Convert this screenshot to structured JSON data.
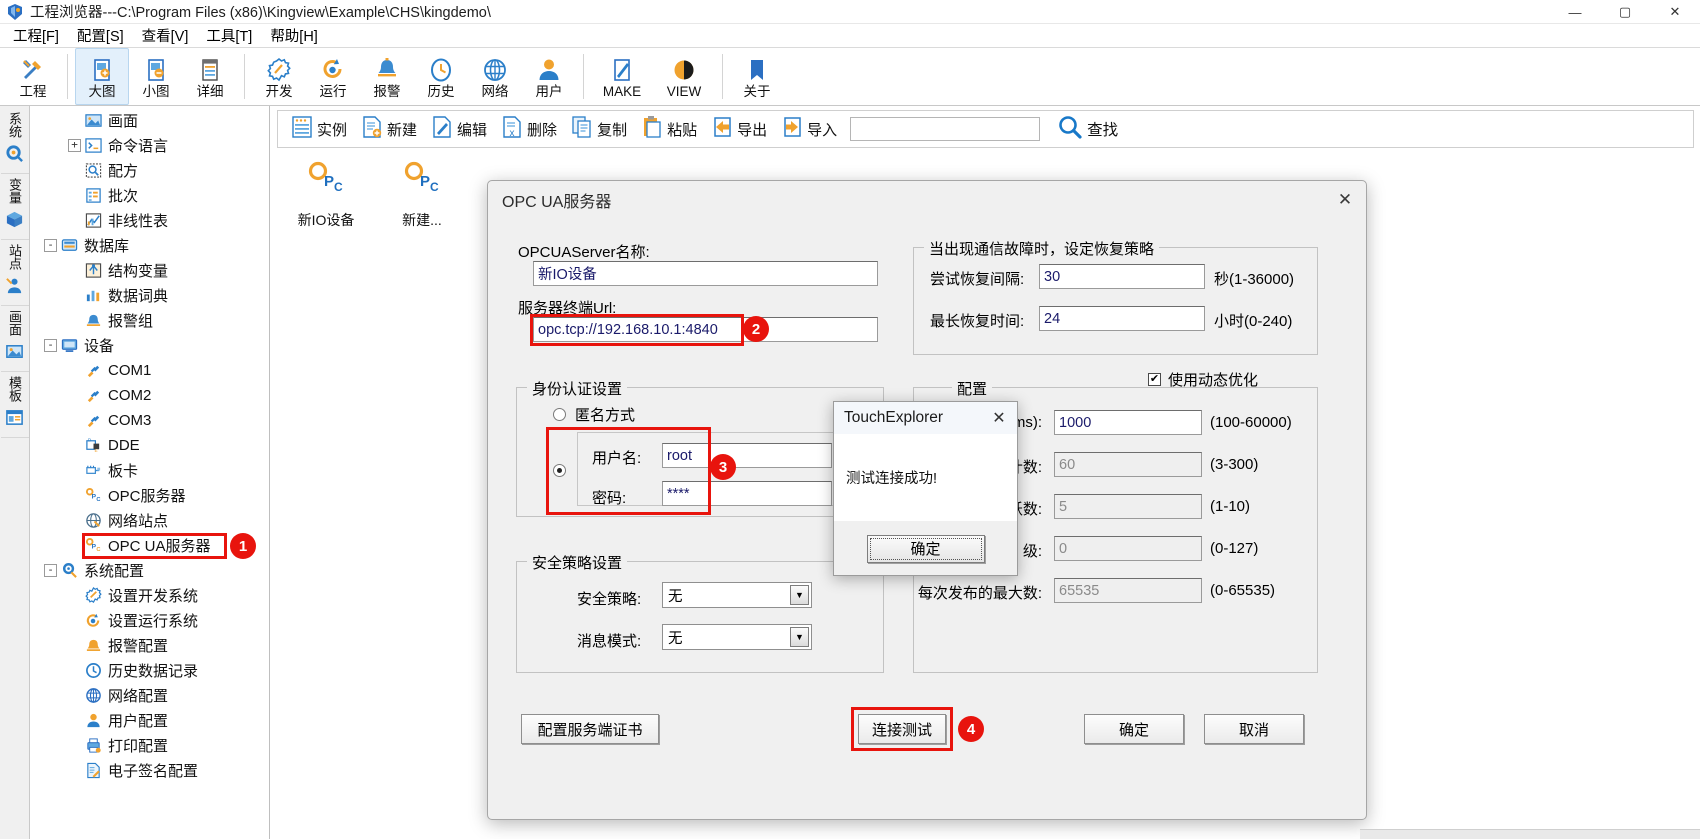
{
  "window": {
    "title": "工程浏览器---C:\\Program Files (x86)\\Kingview\\Example\\CHS\\kingdemo\\",
    "minimize": "—",
    "maximize": "▢",
    "close": "✕"
  },
  "menubar": {
    "items": [
      {
        "label": "工程[F]"
      },
      {
        "label": "配置[S]"
      },
      {
        "label": "查看[V]"
      },
      {
        "label": "工具[T]"
      },
      {
        "label": "帮助[H]"
      }
    ]
  },
  "toolbar": {
    "groups": [
      {
        "items": [
          {
            "label": "工程",
            "icon": "tools-icon",
            "active": false
          }
        ]
      },
      {
        "items": [
          {
            "label": "大图",
            "icon": "large-icons-icon",
            "active": true
          },
          {
            "label": "小图",
            "icon": "small-icons-icon",
            "active": false
          },
          {
            "label": "详细",
            "icon": "details-icon",
            "active": false
          }
        ]
      },
      {
        "items": [
          {
            "label": "开发",
            "icon": "develop-icon",
            "active": false
          },
          {
            "label": "运行",
            "icon": "run-icon",
            "active": false
          },
          {
            "label": "报警",
            "icon": "alarm-icon",
            "active": false
          },
          {
            "label": "历史",
            "icon": "history-icon",
            "active": false
          },
          {
            "label": "网络",
            "icon": "network-icon",
            "active": false
          },
          {
            "label": "用户",
            "icon": "user-icon",
            "active": false
          }
        ]
      },
      {
        "items": [
          {
            "label": "MAKE",
            "icon": "make-icon",
            "active": false
          },
          {
            "label": "VIEW",
            "icon": "view-icon",
            "active": false
          }
        ]
      },
      {
        "items": [
          {
            "label": "关于",
            "icon": "about-icon",
            "active": false
          }
        ]
      }
    ]
  },
  "vtabs": {
    "items": [
      {
        "label": "系统",
        "icon": "system-gear-icon"
      },
      {
        "label": "变量",
        "icon": "variable-box-icon"
      },
      {
        "label": "站点",
        "icon": "site-node-icon"
      },
      {
        "label": "画面",
        "icon": "picture-icon"
      },
      {
        "label": "模板",
        "icon": "template-icon"
      }
    ]
  },
  "tree": {
    "nodes": [
      {
        "label": "画面",
        "depth": 2,
        "expander": "",
        "icon": "picture-node-icon"
      },
      {
        "label": "命令语言",
        "depth": 2,
        "expander": "+",
        "icon": "command-lang-icon"
      },
      {
        "label": "配方",
        "depth": 2,
        "expander": "",
        "icon": "recipe-icon"
      },
      {
        "label": "批次",
        "depth": 2,
        "expander": "",
        "icon": "batch-icon"
      },
      {
        "label": "非线性表",
        "depth": 2,
        "expander": "",
        "icon": "nonlinear-table-icon"
      },
      {
        "label": "数据库",
        "depth": 1,
        "expander": "-",
        "icon": "database-icon"
      },
      {
        "label": "结构变量",
        "depth": 2,
        "expander": "",
        "icon": "struct-var-icon"
      },
      {
        "label": "数据词典",
        "depth": 2,
        "expander": "",
        "icon": "data-dict-icon"
      },
      {
        "label": "报警组",
        "depth": 2,
        "expander": "",
        "icon": "alarm-group-icon"
      },
      {
        "label": "设备",
        "depth": 1,
        "expander": "-",
        "icon": "device-icon"
      },
      {
        "label": "COM1",
        "depth": 2,
        "expander": "",
        "icon": "com-port-icon"
      },
      {
        "label": "COM2",
        "depth": 2,
        "expander": "",
        "icon": "com-port-icon"
      },
      {
        "label": "COM3",
        "depth": 2,
        "expander": "",
        "icon": "com-port-icon"
      },
      {
        "label": "DDE",
        "depth": 2,
        "expander": "",
        "icon": "dde-icon"
      },
      {
        "label": "板卡",
        "depth": 2,
        "expander": "",
        "icon": "board-card-icon"
      },
      {
        "label": "OPC服务器",
        "depth": 2,
        "expander": "",
        "icon": "opc-server-icon"
      },
      {
        "label": "网络站点",
        "depth": 2,
        "expander": "",
        "icon": "net-site-icon"
      },
      {
        "label": "OPC UA服务器",
        "depth": 2,
        "expander": "",
        "icon": "opc-ua-server-icon",
        "highlight": true,
        "badge": "1"
      },
      {
        "label": "系统配置",
        "depth": 1,
        "expander": "-",
        "icon": "sysconfig-icon"
      },
      {
        "label": "设置开发系统",
        "depth": 2,
        "expander": "",
        "icon": "dev-system-icon"
      },
      {
        "label": "设置运行系统",
        "depth": 2,
        "expander": "",
        "icon": "run-system-icon"
      },
      {
        "label": "报警配置",
        "depth": 2,
        "expander": "",
        "icon": "alarm-config-icon"
      },
      {
        "label": "历史数据记录",
        "depth": 2,
        "expander": "",
        "icon": "history-data-icon"
      },
      {
        "label": "网络配置",
        "depth": 2,
        "expander": "",
        "icon": "net-config-icon"
      },
      {
        "label": "用户配置",
        "depth": 2,
        "expander": "",
        "icon": "user-config-icon"
      },
      {
        "label": "打印配置",
        "depth": 2,
        "expander": "",
        "icon": "print-config-icon"
      },
      {
        "label": "电子签名配置",
        "depth": 2,
        "expander": "",
        "icon": "esign-config-icon"
      }
    ]
  },
  "subtoolbar": {
    "buttons": [
      {
        "label": "实例",
        "icon": "instance-icon"
      },
      {
        "label": "新建",
        "icon": "new-icon"
      },
      {
        "label": "编辑",
        "icon": "edit-icon"
      },
      {
        "label": "删除",
        "icon": "delete-icon"
      },
      {
        "label": "复制",
        "icon": "copy-icon"
      },
      {
        "label": "粘贴",
        "icon": "paste-icon"
      },
      {
        "label": "导出",
        "icon": "export-icon"
      },
      {
        "label": "导入",
        "icon": "import-icon"
      }
    ],
    "search_value": "",
    "search_label": "查找",
    "search_icon": "search-icon"
  },
  "desktop_icons": [
    {
      "label": "新IO设备",
      "icon": "opc-device-icon"
    },
    {
      "label": "新建...",
      "icon": "opc-new-icon"
    }
  ],
  "dialog": {
    "title": "OPC UA服务器",
    "close": "✕",
    "server_name_label": "OPCUAServer名称:",
    "server_name_value": "新IO设备",
    "endpoint_label": "服务器终端Url:",
    "endpoint_value": "opc.tcp://192.168.10.1:4840",
    "endpoint_badge": "2",
    "recovery": {
      "title": "当出现通信故障时，设定恢复策略",
      "interval_label": "尝试恢复间隔:",
      "interval_value": "30",
      "interval_unit": "秒(1-36000)",
      "maxtime_label": "最长恢复时间:",
      "maxtime_value": "24",
      "maxtime_unit": "小时(0-240)"
    },
    "dynamic_opt": {
      "label": "使用动态优化",
      "checked": true,
      "mark": "✔"
    },
    "auth": {
      "title": "身份认证设置",
      "anonymous_label": "匿名方式",
      "anonymous_selected": false,
      "userpass_selected": true,
      "username_label": "用户名:",
      "username_value": "root",
      "password_label": "密码:",
      "password_value": "****",
      "badge": "3"
    },
    "security": {
      "title": "安全策略设置",
      "policy_label": "安全策略:",
      "policy_value": "无",
      "mode_label": "消息模式:",
      "mode_value": "无",
      "arrow": "▼"
    },
    "advanced": {
      "title": "配置",
      "rows": [
        {
          "label": "(ms):",
          "value": "1000",
          "range": "(100-60000)",
          "disabled": false
        },
        {
          "label": "计数:",
          "value": "60",
          "range": "(3-300)",
          "disabled": true
        },
        {
          "label": "活跃数:",
          "value": "5",
          "range": "(1-10)",
          "disabled": true
        },
        {
          "label": "级:",
          "value": "0",
          "range": "(0-127)",
          "disabled": true
        },
        {
          "label": "每次发布的最大数:",
          "value": "65535",
          "range": "(0-65535)",
          "disabled": true
        }
      ]
    },
    "buttons": {
      "cert": "配置服务端证书",
      "test": "连接测试",
      "test_badge": "4",
      "ok": "确定",
      "cancel": "取消"
    }
  },
  "msgbox": {
    "title": "TouchExplorer",
    "close": "✕",
    "message": "测试连接成功!",
    "ok": "确定"
  }
}
